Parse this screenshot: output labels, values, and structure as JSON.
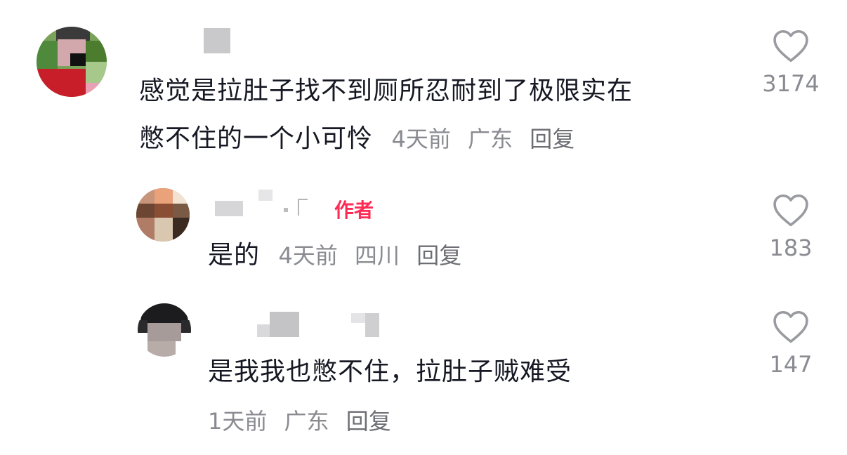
{
  "comments": [
    {
      "text_line1": "感觉是拉肚子找不到厕所忍耐到了极限实在",
      "text_line2": "憋不住的一个小可怜",
      "time": "4天前",
      "location": "广东",
      "reply_label": "回复",
      "likes": "3174"
    },
    {
      "badge": "作者",
      "text": "是的",
      "time": "4天前",
      "location": "四川",
      "reply_label": "回复",
      "likes": "183"
    },
    {
      "text": "是我我也憋不住，拉肚子贼难受",
      "time": "1天前",
      "location": "广东",
      "reply_label": "回复",
      "likes": "147"
    }
  ],
  "icons": {
    "like": "heart-outline-icon"
  },
  "colors": {
    "text": "#161823",
    "meta": "#8a8b91",
    "author": "#fe2c55"
  }
}
